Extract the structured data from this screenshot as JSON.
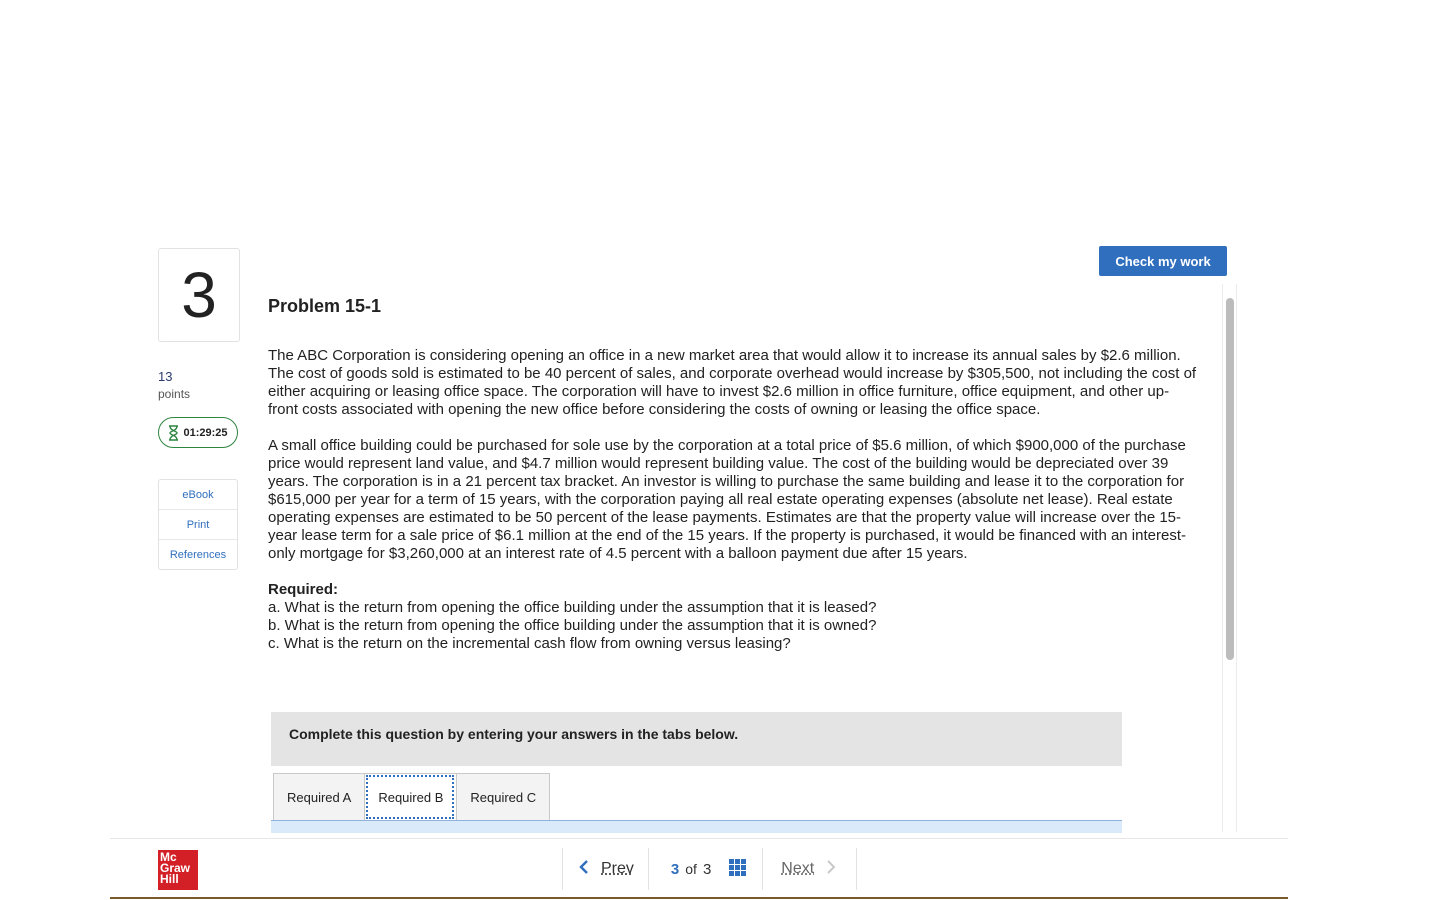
{
  "toolbar": {
    "check_label": "Check my work"
  },
  "question": {
    "number": "3",
    "points_value": "13",
    "points_label": "points",
    "timer": "01:29:25",
    "title": "Problem 15-1"
  },
  "tools": [
    {
      "label": "eBook"
    },
    {
      "label": "Print"
    },
    {
      "label": "References"
    }
  ],
  "body": {
    "para1": "The ABC Corporation is considering opening an office in a new market area that would allow it to increase its annual sales by $2.6 million. The cost of goods sold is estimated to be 40 percent of sales, and corporate overhead would increase by $305,500, not including the cost of either acquiring or leasing office space. The corporation will have to invest $2.6 million in office furniture, office equipment, and other up-front costs associated with opening the new office before considering the costs of owning or leasing the office space.",
    "para2": "A small office building could be purchased for sole use by the corporation at a total price of $5.6 million, of which $900,000 of the purchase price would represent land value, and $4.7 million would represent building value. The cost of the building would be depreciated over 39 years. The corporation is in a 21 percent tax bracket. An investor is willing to purchase the same building and lease it to the corporation for $615,000 per year for a term of 15 years, with the corporation paying all real estate operating expenses (absolute net lease). Real estate operating expenses are estimated to be 50 percent of the lease payments. Estimates are that the property value will increase over the 15-year lease term for a sale price of $6.1 million at the end of the 15 years. If the property is purchased, it would be financed with an interest-only mortgage for $3,260,000 at an interest rate of 4.5 percent with a balloon payment due after 15 years.",
    "required_title": "Required:",
    "req_a": "a. What is the return from opening the office building under the assumption that it is leased?",
    "req_b": "b. What is the return from opening the office building under the assumption that it is owned?",
    "req_c": "c. What is the return on the incremental cash flow from owning versus leasing?"
  },
  "instructions": "Complete this question by entering your answers in the tabs below.",
  "tabs": [
    {
      "label": "Required A",
      "active": false
    },
    {
      "label": "Required B",
      "active": true
    },
    {
      "label": "Required C",
      "active": false
    }
  ],
  "footer": {
    "logo_lines": [
      "Mc",
      "Graw",
      "Hill"
    ],
    "prev_label": "Prev",
    "current_page": "3",
    "of_label": "of",
    "total_pages": "3",
    "next_label": "Next"
  },
  "colors": {
    "accent": "#2f6fbd",
    "timer_border": "#2e8540",
    "logo_red": "#d31f26"
  }
}
